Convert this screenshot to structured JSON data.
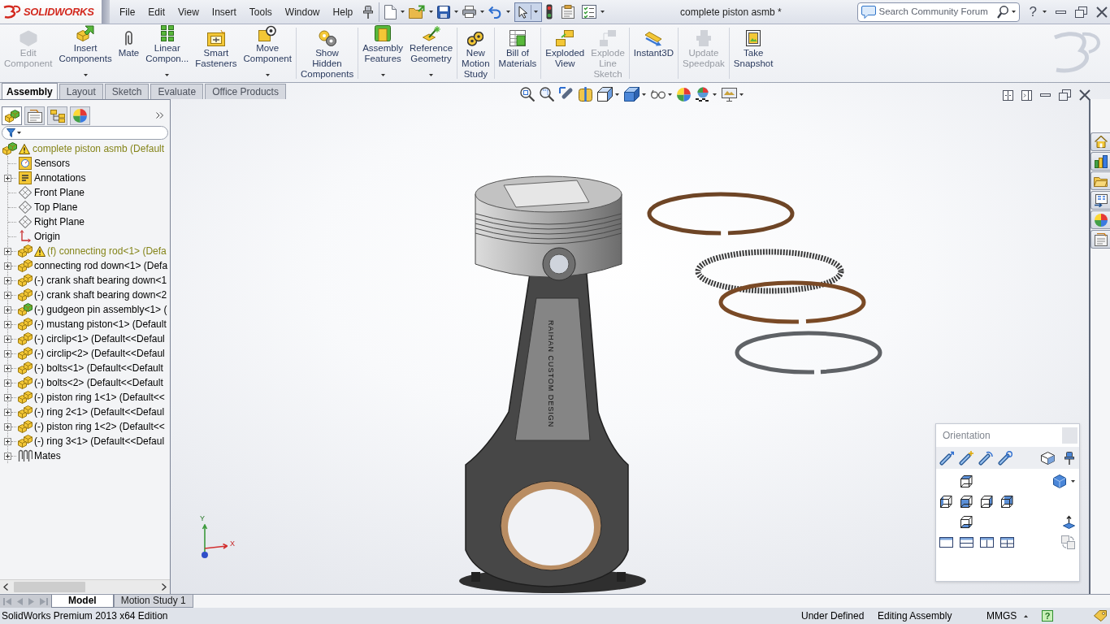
{
  "title_bar": {
    "logo": "SOLIDWORKS",
    "menu": [
      "File",
      "Edit",
      "View",
      "Insert",
      "Tools",
      "Window",
      "Help"
    ],
    "select_tool_pressed": true,
    "document_title": "complete piston asmb *",
    "search": {
      "placeholder": "Search Community Forum"
    },
    "help": "?"
  },
  "ribbon": [
    [
      {
        "kind": "edit",
        "lines": [
          "Edit",
          "Component"
        ],
        "disabled": true,
        "dropdown": false
      },
      {
        "kind": "insert",
        "lines": [
          "Insert",
          "Components"
        ],
        "disabled": false,
        "dropdown": true
      },
      {
        "kind": "mate",
        "lines": [
          "Mate"
        ],
        "disabled": false,
        "dropdown": false
      },
      {
        "kind": "pattern",
        "lines": [
          "Linear",
          "Compon..."
        ],
        "disabled": false,
        "dropdown": true
      },
      {
        "kind": "fastener",
        "lines": [
          "Smart",
          "Fasteners"
        ],
        "disabled": false,
        "dropdown": false
      },
      {
        "kind": "move",
        "lines": [
          "Move",
          "Component"
        ],
        "disabled": false,
        "dropdown": true
      }
    ],
    [
      {
        "kind": "show",
        "lines": [
          "Show",
          "Hidden",
          "Components"
        ],
        "disabled": false,
        "dropdown": false
      }
    ],
    [
      {
        "kind": "features",
        "lines": [
          "Assembly",
          "Features"
        ],
        "disabled": false,
        "dropdown": true
      },
      {
        "kind": "geometry",
        "lines": [
          "Reference",
          "Geometry"
        ],
        "disabled": false,
        "dropdown": true
      }
    ],
    [
      {
        "kind": "motion",
        "lines": [
          "New",
          "Motion",
          "Study"
        ],
        "disabled": false,
        "dropdown": false
      }
    ],
    [
      {
        "kind": "bom",
        "lines": [
          "Bill of",
          "Materials"
        ],
        "disabled": false,
        "dropdown": false
      }
    ],
    [
      {
        "kind": "explode",
        "lines": [
          "Exploded",
          "View"
        ],
        "disabled": false,
        "dropdown": false
      },
      {
        "kind": "explodeline",
        "lines": [
          "Explode",
          "Line",
          "Sketch"
        ],
        "disabled": true,
        "dropdown": false
      }
    ],
    [
      {
        "kind": "instant3d",
        "lines": [
          "Instant3D"
        ],
        "disabled": false,
        "dropdown": false
      }
    ],
    [
      {
        "kind": "speedpak",
        "lines": [
          "Update",
          "Speedpak"
        ],
        "disabled": true,
        "dropdown": false
      }
    ],
    [
      {
        "kind": "snapshot",
        "lines": [
          "Take",
          "Snapshot"
        ],
        "disabled": false,
        "dropdown": false
      }
    ]
  ],
  "tabs": [
    {
      "label": "Assembly",
      "selected": true
    },
    {
      "label": "Layout",
      "selected": false
    },
    {
      "label": "Sketch",
      "selected": false
    },
    {
      "label": "Evaluate",
      "selected": false
    },
    {
      "label": "Office Products",
      "selected": false
    }
  ],
  "panel_tabs": [
    {
      "kind": "feature",
      "selected": true
    },
    {
      "kind": "property",
      "selected": false
    },
    {
      "kind": "config",
      "selected": false
    },
    {
      "kind": "display",
      "selected": false
    }
  ],
  "tree": {
    "label": "complete piston asmb (Default",
    "kind": "assembly",
    "warning": true,
    "children": [
      {
        "label": "Sensors",
        "kind": "sensors",
        "warning": false,
        "has_children": false
      },
      {
        "label": "Annotations",
        "kind": "annotations",
        "warning": false,
        "has_children": true
      },
      {
        "label": "Front Plane",
        "kind": "plane",
        "warning": false,
        "has_children": false
      },
      {
        "label": "Top Plane",
        "kind": "plane",
        "warning": false,
        "has_children": false
      },
      {
        "label": "Right Plane",
        "kind": "plane",
        "warning": false,
        "has_children": false
      },
      {
        "label": "Origin",
        "kind": "origin",
        "warning": false,
        "has_children": false
      },
      {
        "label": "(f) connecting rod<1> (Defa",
        "kind": "part",
        "warning": true,
        "has_children": true
      },
      {
        "label": "connecting rod down<1> (Defa",
        "kind": "part",
        "warning": false,
        "has_children": true
      },
      {
        "label": "(-) crank shaft bearing down<1",
        "kind": "part",
        "warning": false,
        "has_children": true
      },
      {
        "label": "(-) crank shaft bearing down<2",
        "kind": "part",
        "warning": false,
        "has_children": true
      },
      {
        "label": "(-) gudgeon pin assembly<1> (",
        "kind": "assembly",
        "warning": false,
        "has_children": true
      },
      {
        "label": "(-) mustang piston<1> (Default",
        "kind": "part",
        "warning": false,
        "has_children": true
      },
      {
        "label": "(-) circlip<1> (Default<<Defaul",
        "kind": "part",
        "warning": false,
        "has_children": true
      },
      {
        "label": "(-) circlip<2> (Default<<Defaul",
        "kind": "part",
        "warning": false,
        "has_children": true
      },
      {
        "label": "(-) bolts<1> (Default<<Default",
        "kind": "part",
        "warning": false,
        "has_children": true
      },
      {
        "label": "(-) bolts<2> (Default<<Default",
        "kind": "part",
        "warning": false,
        "has_children": true
      },
      {
        "label": "(-) piston ring 1<1> (Default<<",
        "kind": "part",
        "warning": false,
        "has_children": true
      },
      {
        "label": "(-) ring 2<1> (Default<<Defaul",
        "kind": "part",
        "warning": false,
        "has_children": true
      },
      {
        "label": "(-) piston ring 1<2> (Default<<",
        "kind": "part",
        "warning": false,
        "has_children": true
      },
      {
        "label": "(-) ring 3<1> (Default<<Defaul",
        "kind": "part",
        "warning": false,
        "has_children": true
      },
      {
        "label": "Mates",
        "kind": "mates",
        "warning": false,
        "has_children": true
      }
    ]
  },
  "viewport": {
    "engraving": "RAIHAN CUSTOM DESIGN",
    "triad": {
      "y": "Y",
      "x": "X"
    },
    "orientation": {
      "title": "Orientation"
    }
  },
  "bottom_tabs": [
    {
      "label": "Model",
      "selected": true
    },
    {
      "label": "Motion Study 1",
      "selected": false
    }
  ],
  "status_bar": {
    "product": "SolidWorks Premium 2013 x64 Edition",
    "state": "Under Defined",
    "mode": "Editing Assembly",
    "units": "MMGS",
    "help": "?"
  }
}
